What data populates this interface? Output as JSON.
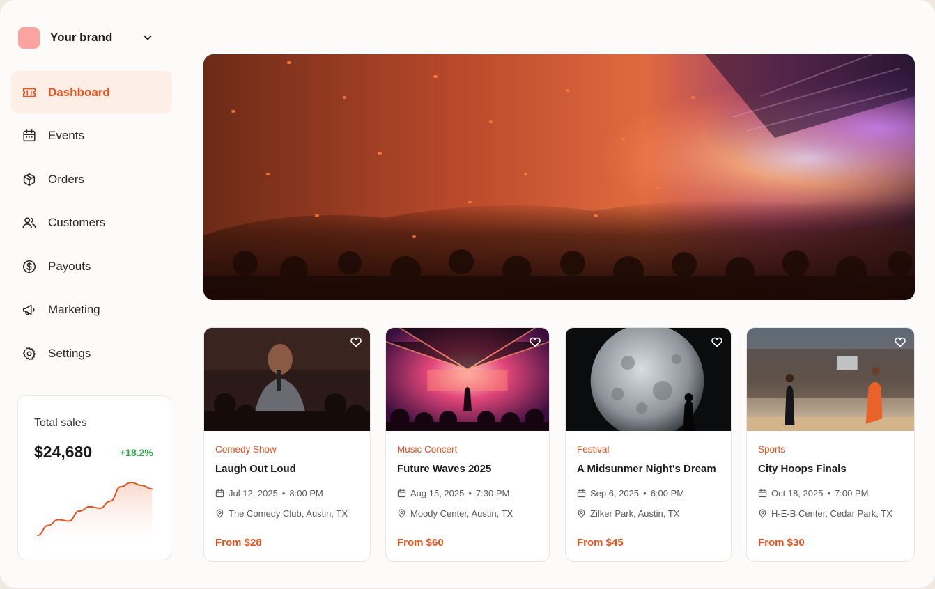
{
  "brand": {
    "name": "Your brand",
    "logo_color": "#fba3a0"
  },
  "colors": {
    "accent": "#e8501c",
    "positive": "#2fa34a",
    "active_bg": "#fdeee6"
  },
  "nav": [
    {
      "label": "Dashboard",
      "icon": "ticket-icon",
      "active": true
    },
    {
      "label": "Events",
      "icon": "calendar-icon",
      "active": false
    },
    {
      "label": "Orders",
      "icon": "box-icon",
      "active": false
    },
    {
      "label": "Customers",
      "icon": "users-icon",
      "active": false
    },
    {
      "label": "Payouts",
      "icon": "dollar-circle-icon",
      "active": false
    },
    {
      "label": "Marketing",
      "icon": "megaphone-icon",
      "active": false
    },
    {
      "label": "Settings",
      "icon": "gear-icon",
      "active": false
    }
  ],
  "sales": {
    "title": "Total sales",
    "value": "$24,680",
    "change": "+18.2%"
  },
  "chart_data": {
    "type": "line",
    "title": "",
    "series": [
      {
        "values": [
          10,
          24,
          32,
          30,
          44,
          50,
          48,
          58,
          78,
          84,
          80,
          75
        ]
      }
    ],
    "grid": false
  },
  "hero": {
    "image": "concert-crowd-confetti"
  },
  "events": [
    {
      "category": "Comedy Show",
      "title": "Laugh Out Loud",
      "date": "Jul 12, 2025",
      "time": "8:00 PM",
      "location": "The Comedy Club, Austin, TX",
      "price": "From $28",
      "image": "comedian-with-microphone"
    },
    {
      "category": "Music Concert",
      "title": "Future Waves 2025",
      "date": "Aug 15, 2025",
      "time": "7:30 PM",
      "location": "Moody Center, Austin, TX",
      "price": "From $60",
      "image": "concert-stage-lights"
    },
    {
      "category": "Festival",
      "title": "A Midsunmer Night's Dream",
      "date": "Sep 6, 2025",
      "time": "6:00 PM",
      "location": "Zilker Park, Austin, TX",
      "price": "From $45",
      "image": "moon-silhouette"
    },
    {
      "category": "Sports",
      "title": "City Hoops Finals",
      "date": "Oct 18, 2025",
      "time": "7:00 PM",
      "location": "H-E-B Center, Cedar Park, TX",
      "price": "From $30",
      "image": "basketball-arena"
    }
  ]
}
